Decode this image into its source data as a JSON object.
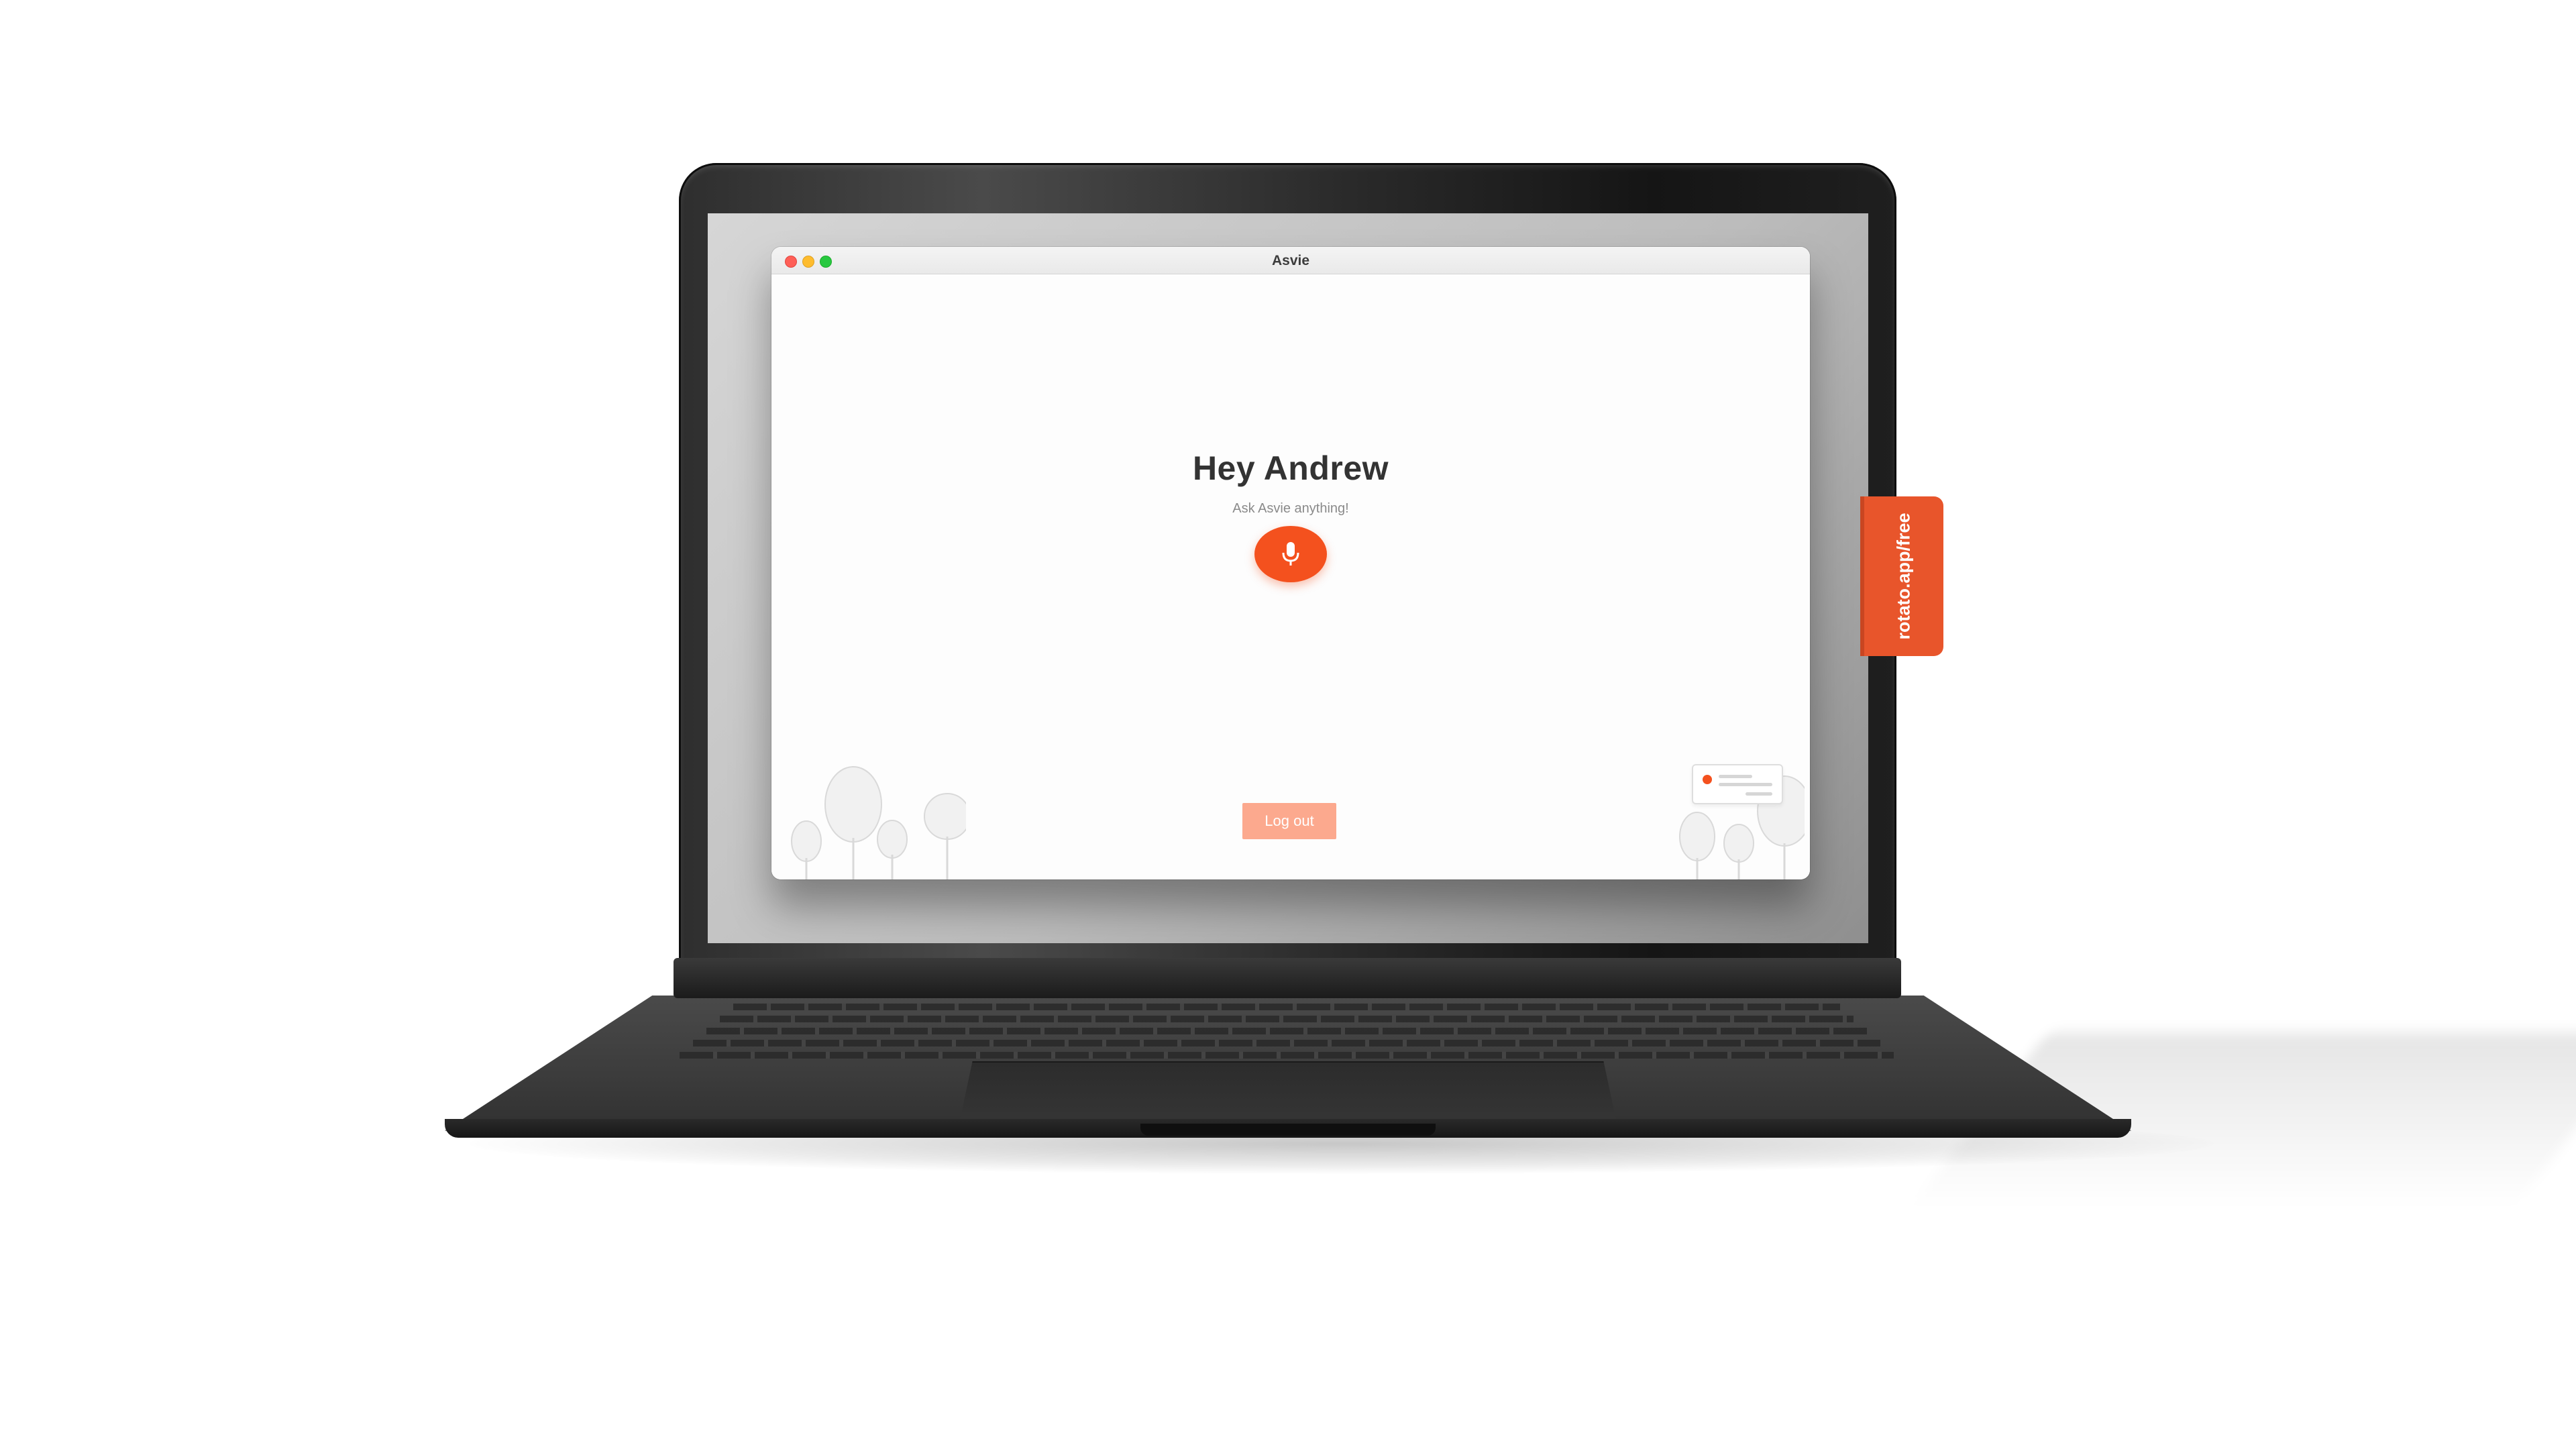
{
  "window": {
    "title": "Asvie"
  },
  "main": {
    "greeting": "Hey Andrew",
    "subtitle": "Ask Asvie anything!",
    "mic_icon": "microphone-icon",
    "logout_label": "Log out"
  },
  "watermark": {
    "text": "rotato.app/free"
  },
  "colors": {
    "accent": "#f4511e",
    "logout_button": "#fca98e",
    "watermark": "#e8552b",
    "traffic_close": "#fe5f57",
    "traffic_minimize": "#febc2e",
    "traffic_maximize": "#28c840"
  }
}
